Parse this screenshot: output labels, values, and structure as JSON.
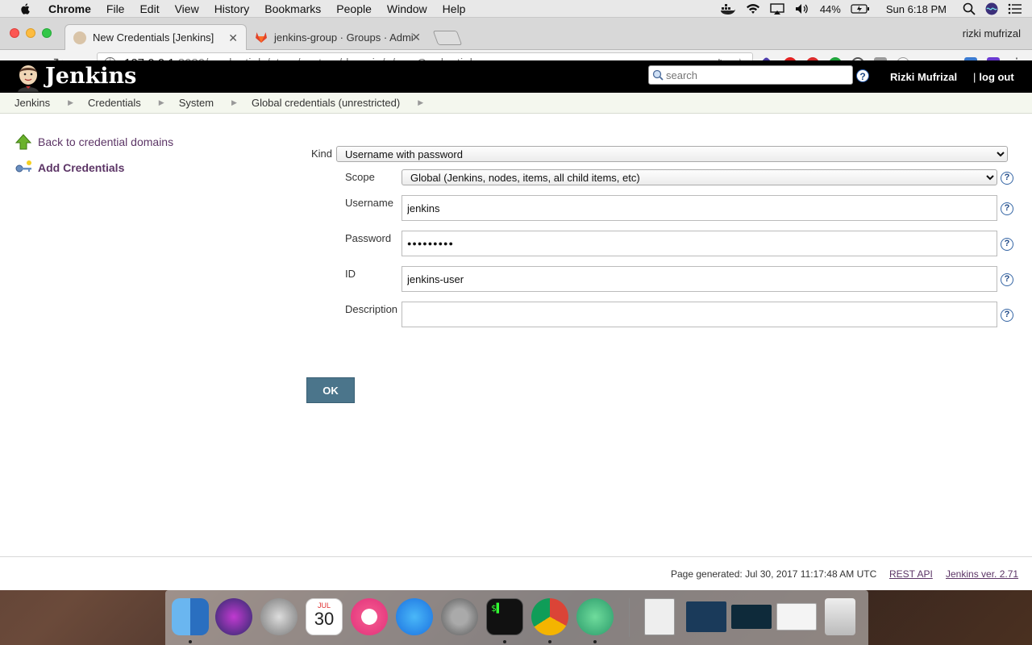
{
  "menubar": {
    "app": "Chrome",
    "items": [
      "File",
      "Edit",
      "View",
      "History",
      "Bookmarks",
      "People",
      "Window",
      "Help"
    ],
    "battery": "44%",
    "clock": "Sun 6:18 PM"
  },
  "browser": {
    "tabs": [
      {
        "title": "New Credentials [Jenkins]",
        "active": true
      },
      {
        "title": "jenkins-group · Groups · Admi",
        "active": false
      }
    ],
    "profile": "rizki mufrizal",
    "url_host": "127.0.0.1",
    "url_path": ":8080/credentials/store/system/domain/_/newCredentials"
  },
  "jenkins": {
    "logo_text": "Jenkins",
    "search_placeholder": "search",
    "user": "Rizki Mufrizal",
    "logout": "log out",
    "breadcrumbs": [
      "Jenkins",
      "Credentials",
      "System",
      "Global credentials (unrestricted)"
    ],
    "side_tasks": [
      {
        "label": "Back to credential domains"
      },
      {
        "label": "Add Credentials"
      }
    ],
    "form": {
      "kind_label": "Kind",
      "kind_value": "Username with password",
      "scope_label": "Scope",
      "scope_value": "Global (Jenkins, nodes, items, all child items, etc)",
      "username_label": "Username",
      "username_value": "jenkins",
      "password_label": "Password",
      "password_value": "●●●●●●●●●",
      "id_label": "ID",
      "id_value": "jenkins-user",
      "description_label": "Description",
      "description_value": "",
      "ok_label": "OK",
      "help_glyph": "?"
    },
    "footer": {
      "generated": "Page generated: Jul 30, 2017 11:17:48 AM UTC",
      "rest_api": "REST API",
      "version": "Jenkins ver. 2.71"
    }
  },
  "dock": {
    "calendar_month": "JUL",
    "calendar_day": "30"
  },
  "colors": {
    "jenkins_header": "#000000",
    "link": "#5c3566",
    "ok_button": "#4b758b",
    "breadcrumb_bg": "#f4f7ee"
  }
}
